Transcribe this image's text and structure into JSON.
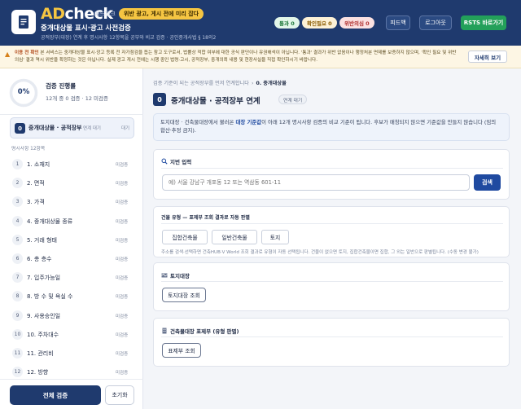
{
  "header": {
    "brand_ad": "AD",
    "brand_check": "check",
    "brand_sub": "애드체크",
    "warn_badge": "위반 광고, 게시 전에 미리 잡다",
    "title": "중개대상물 표시·광고 사전검증",
    "desc": "공적장부(대장) 연계 후 명시사항 12항목을 공부와 비교 검증 · 공인중개사법 § 18의2",
    "counts": {
      "pass": "통과 0",
      "check": "확인필요 0",
      "violation": "위반의심 0"
    },
    "buttons": {
      "feedback": "피드백",
      "logout": "로그아웃",
      "rsts": "RSTS 바로가기"
    }
  },
  "notice": {
    "lead": "이용 전 확인",
    "text": "본 서비스는 중개대상물 표시·광고 등록 전 자가점검을 돕는 참고 도구로서, 법률상 적합 여부에 대한 공식 판단이나 유권해석이 아닙니다. '통과' 결과가 위반 없음이나 행정처분 면제를 보증하지 않으며, '확인 필요 및 위반의심' 결과 역시 위반을 확정하는 것은 아닙니다. 실제 광고 게시 전에는 시행 중인 법령·고시, 공적장부, 중개의뢰 내용 및 현장사실을 직접 확인하시기 바랍니다.",
    "button": "자세히 보기"
  },
  "sidebar": {
    "progress": {
      "percent": "0%",
      "title": "검증 진행률",
      "summary": "12개 중 0 검증 · 12 미검증",
      "fraction": 0
    },
    "active_item": {
      "num": "0",
      "label": "중개대상물 · 공적장부",
      "sub": "연계 대기",
      "status": "대기"
    },
    "section_label": "명시사항 12항목",
    "items": [
      {
        "num": "1",
        "label": "1. 소재지",
        "status": "미검증"
      },
      {
        "num": "2",
        "label": "2. 면적",
        "status": "미검증"
      },
      {
        "num": "3",
        "label": "3. 가격",
        "status": "미검증"
      },
      {
        "num": "4",
        "label": "4. 중개대상물 종류",
        "status": "미검증"
      },
      {
        "num": "5",
        "label": "5. 거래 형태",
        "status": "미검증"
      },
      {
        "num": "6",
        "label": "6. 총 층수",
        "status": "미검증"
      },
      {
        "num": "7",
        "label": "7. 입주가능일",
        "status": "미검증"
      },
      {
        "num": "8",
        "label": "8. 방 수 및 욕실 수",
        "status": "미검증"
      },
      {
        "num": "9",
        "label": "9. 사용승인일",
        "status": "미검증"
      },
      {
        "num": "10",
        "label": "10. 주차대수",
        "status": "미검증"
      },
      {
        "num": "11",
        "label": "11. 관리비",
        "status": "미검증"
      },
      {
        "num": "12",
        "label": "12. 방향",
        "status": "미검증"
      }
    ],
    "run_button": "전체 검증",
    "reset_button": "초기화"
  },
  "main": {
    "breadcrumb": {
      "prefix": "검증 기준이 되는 공적장부를 먼저 연계합니다",
      "sep": "›",
      "current": "0. 중개대상물"
    },
    "title_num": "0",
    "title": "중개대상물 · 공적장부 연계",
    "title_badge": "연계 대기",
    "info": {
      "part1": "토지대장 · 건축물대장에서 불러온 ",
      "highlight": "대장 기준값",
      "part2": "이 아래 12개 명시사항 검증의 비교 기준이 됩니다. 후보가 매칭되지 않으면 기준값을 만들지 않습니다 (임의 합산·추정 금지)."
    },
    "address": {
      "title": "지번 입력",
      "placeholder": "예) 서울 강남구 개포동 12 또는 역삼동 601-11",
      "search": "검색"
    },
    "building_type": {
      "title": "건물 유형 — 표제부 조회 결과로 자동 판별",
      "options": [
        "집합건축물",
        "일반건축물",
        "토지"
      ],
      "hint": "주소를 검색·선택하면 건축HUB·V World 조회 결과로 유형이 자동 선택됩니다. 건물이 없으면 토지, 집합건축물이면 집합, 그 외는 일반으로 판별됩니다. (수동 변경 불가)"
    },
    "land": {
      "title": "토지대장",
      "button": "토지대장 조회"
    },
    "building": {
      "title": "건축물대장 표제부 (유형 판별)",
      "button": "표제부 조회"
    }
  },
  "colors": {
    "navy": "#1f3a6e",
    "accent_yellow": "#f5c542",
    "green": "#23a05a",
    "blue": "#1f4aa0"
  }
}
